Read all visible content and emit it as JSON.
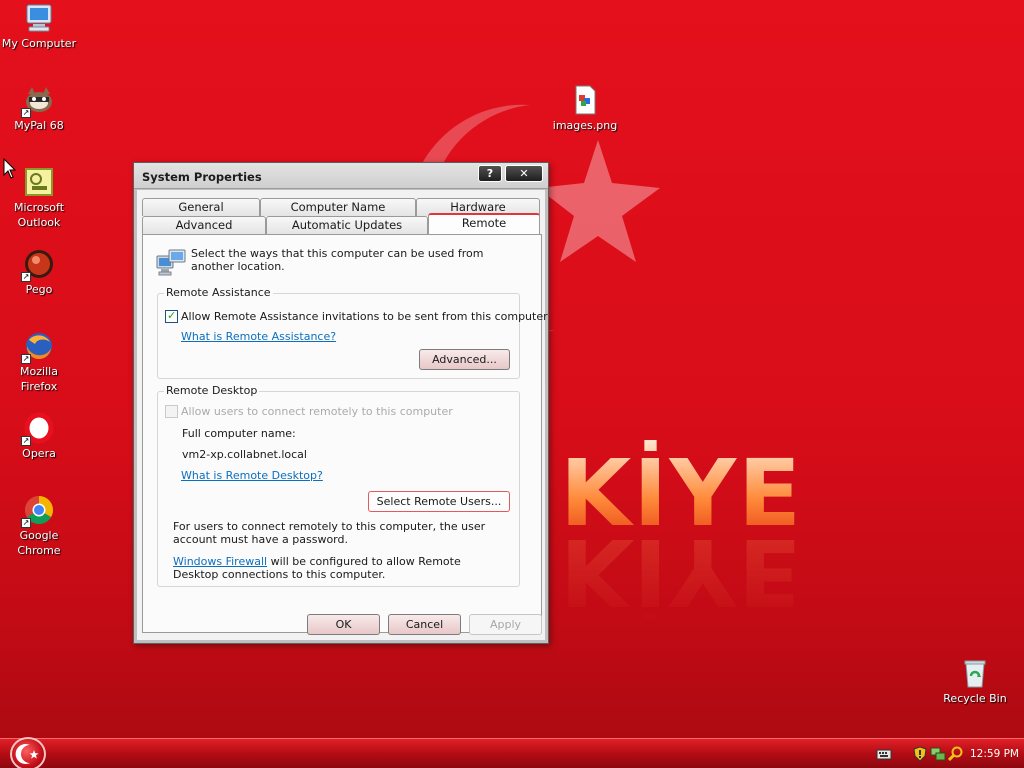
{
  "desktop": {
    "icons": [
      {
        "name": "my-computer",
        "label": "My Computer"
      },
      {
        "name": "mypal",
        "label": "MyPal 68"
      },
      {
        "name": "outlook",
        "label": "Microsoft Outlook"
      },
      {
        "name": "pego",
        "label": "Pego"
      },
      {
        "name": "firefox",
        "label": "Mozilla Firefox"
      },
      {
        "name": "opera",
        "label": "Opera"
      },
      {
        "name": "chrome",
        "label": "Google Chrome"
      },
      {
        "name": "images-png",
        "label": "images.png"
      },
      {
        "name": "recycle-bin",
        "label": "Recycle Bin"
      }
    ],
    "wallpaper_text": "KİYE"
  },
  "dialog": {
    "title": "System Properties",
    "help_button": "?",
    "close_button": "✕",
    "tabs_row1": [
      "General",
      "Computer Name",
      "Hardware"
    ],
    "tabs_row2": [
      "Advanced",
      "Automatic Updates",
      "Remote"
    ],
    "active_tab": "Remote",
    "intro": "Select the ways that this computer can be used from another location.",
    "remote_assistance": {
      "group_label": "Remote Assistance",
      "checkbox_label": "Allow Remote Assistance invitations to be sent from this computer",
      "checked": true,
      "link": "What is Remote Assistance?",
      "advanced_button": "Advanced..."
    },
    "remote_desktop": {
      "group_label": "Remote Desktop",
      "checkbox_label": "Allow users to connect remotely to this computer",
      "checked": false,
      "full_name_label": "Full computer name:",
      "computer_name": "vm2-xp.collabnet.local",
      "link": "What is Remote Desktop?",
      "select_users_button": "Select Remote Users...",
      "note": "For users to connect remotely to this computer, the user account must have a password.",
      "firewall_link": "Windows Firewall",
      "firewall_text": " will be configured to allow Remote Desktop connections to this computer."
    },
    "buttons": {
      "ok": "OK",
      "cancel": "Cancel",
      "apply": "Apply"
    }
  },
  "taskbar": {
    "clock": "12:59 PM"
  },
  "colors": {
    "wallpaper": "#d70d19",
    "accent": "#e0353a",
    "link": "#0b6fc0"
  }
}
